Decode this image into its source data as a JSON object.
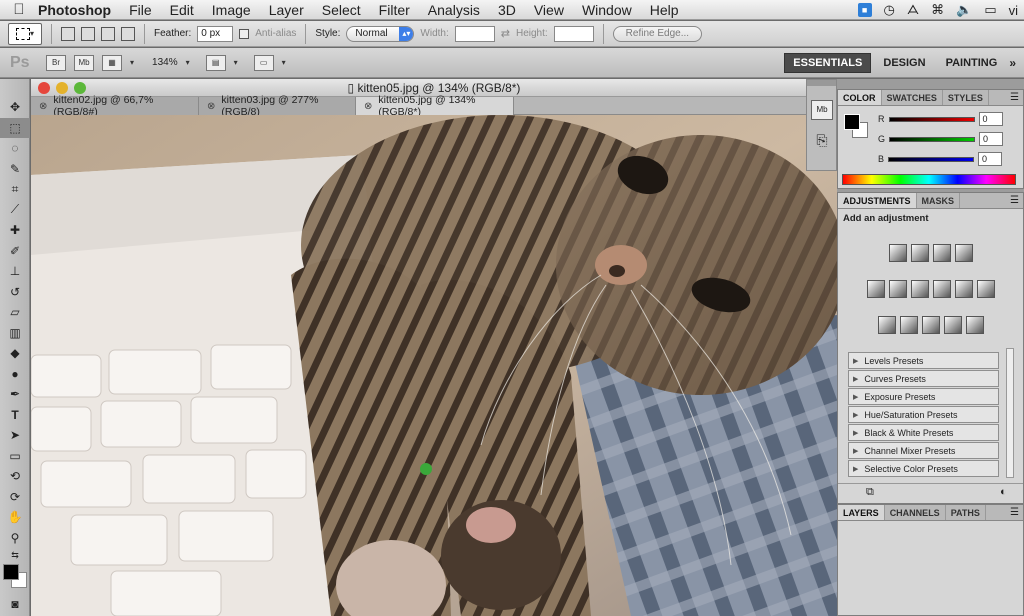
{
  "menubar": {
    "app_name": "Photoshop",
    "items": [
      "File",
      "Edit",
      "Image",
      "Layer",
      "Select",
      "Filter",
      "Analysis",
      "3D",
      "View",
      "Window",
      "Help"
    ],
    "right_clip": "vi"
  },
  "options_bar": {
    "feather_label": "Feather:",
    "feather_value": "0 px",
    "antialias_label": "Anti-alias",
    "style_label": "Style:",
    "style_value": "Normal",
    "width_label": "Width:",
    "height_label": "Height:",
    "refine_edge_label": "Refine Edge..."
  },
  "app_bar": {
    "logo": "Ps",
    "br_label": "Br",
    "mb_label": "Mb",
    "zoom": "134%",
    "workspaces": [
      "ESSENTIALS",
      "DESIGN",
      "PAINTING"
    ],
    "active_workspace": "ESSENTIALS",
    "more": "»"
  },
  "document": {
    "title": "kitten05.jpg @ 134% (RGB/8*)",
    "tabs": [
      {
        "label": "kitten02.jpg @ 66,7% (RGB/8#)",
        "active": false
      },
      {
        "label": "kitten03.jpg @ 277% (RGB/8)",
        "active": false
      },
      {
        "label": "kitten05.jpg @ 134% (RGB/8*)",
        "active": true
      }
    ]
  },
  "color_panel": {
    "tabs": [
      "COLOR",
      "SWATCHES",
      "STYLES"
    ],
    "channels": [
      {
        "label": "R",
        "value": "0"
      },
      {
        "label": "G",
        "value": "0"
      },
      {
        "label": "B",
        "value": "0"
      }
    ]
  },
  "adjustments_panel": {
    "tabs": [
      "ADJUSTMENTS",
      "MASKS"
    ],
    "heading": "Add an adjustment",
    "presets": [
      "Levels Presets",
      "Curves Presets",
      "Exposure Presets",
      "Hue/Saturation Presets",
      "Black & White Presets",
      "Channel Mixer Presets",
      "Selective Color Presets"
    ]
  },
  "layers_panel": {
    "tabs": [
      "LAYERS",
      "CHANNELS",
      "PATHS"
    ]
  },
  "colors": {
    "workspace_active_bg": "#4b4b4b",
    "style_arrow": "#3d7ee8"
  }
}
